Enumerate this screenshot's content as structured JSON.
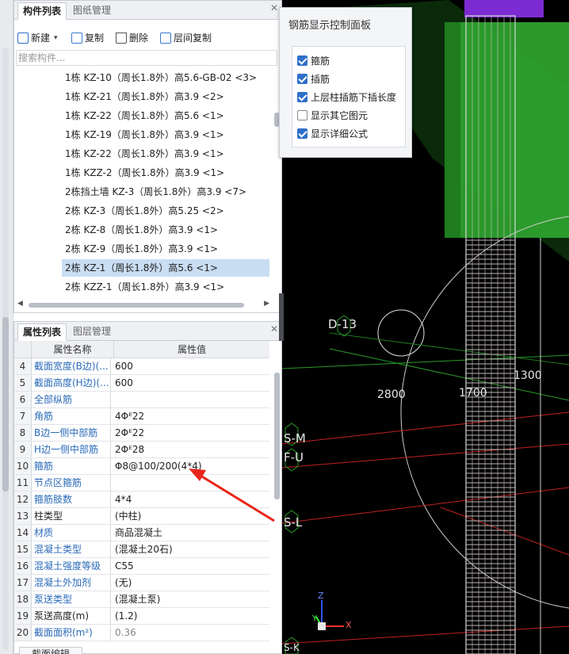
{
  "component_panel": {
    "tabs": [
      "构件列表",
      "图纸管理"
    ],
    "toolbar": {
      "new_label": "新建",
      "copy_label": "复制",
      "delete_label": "删除",
      "floor_copy_label": "层间复制"
    },
    "search_placeholder": "搜索构件...",
    "items": [
      "1栋 KZ-10（周长1.8外）高5.6-GB-02 <3>",
      "1栋 KZ-21（周长1.8外）高3.9 <2>",
      "1栋 KZ-22（周长1.8外）高5.6 <1>",
      "1栋 KZ-19（周长1.8外）高3.9 <1>",
      "1栋 KZ-22（周长1.8外）高3.9 <1>",
      "1栋 KZZ-2（周长1.8外）高3.9 <1>",
      "2栋挡土墙 KZ-3（周长1.8外）高3.9 <7>",
      "2栋 KZ-3（周长1.8外）高5.25 <2>",
      "2栋 KZ-8（周长1.8外）高3.9 <1>",
      "2栋 KZ-9（周长1.8外）高3.9 <1>",
      "2栋 KZ-1（周长1.8外）高5.6 <1>",
      "2栋 KZZ-1（周长1.8外）高3.9 <1>"
    ],
    "selected_index": 10
  },
  "property_panel": {
    "tabs": [
      "属性列表",
      "图层管理"
    ],
    "columns": [
      "属性名称",
      "属性值"
    ],
    "rows": [
      {
        "num": "4",
        "name": "截面宽度(B边)(...",
        "value": "600"
      },
      {
        "num": "5",
        "name": "截面高度(H边)(...",
        "value": "600"
      },
      {
        "num": "6",
        "name": "全部纵筋",
        "value": ""
      },
      {
        "num": "7",
        "name": "角筋",
        "value": "4Φᴱ22"
      },
      {
        "num": "8",
        "name": "B边一侧中部筋",
        "value": "2Φᴱ22"
      },
      {
        "num": "9",
        "name": "H边一侧中部筋",
        "value": "2Φᴱ28"
      },
      {
        "num": "10",
        "name": "箍筋",
        "value": "Φ8@100/200(4*4)"
      },
      {
        "num": "11",
        "name": "节点区箍筋",
        "value": ""
      },
      {
        "num": "12",
        "name": "箍筋肢数",
        "value": "4*4"
      },
      {
        "num": "13",
        "name": "柱类型",
        "value": "(中柱)"
      },
      {
        "num": "14",
        "name": "材质",
        "value": "商品混凝土"
      },
      {
        "num": "15",
        "name": "混凝土类型",
        "value": "(混凝土20石)"
      },
      {
        "num": "16",
        "name": "混凝土强度等级",
        "value": "C55"
      },
      {
        "num": "17",
        "name": "混凝土外加剂",
        "value": "(无)"
      },
      {
        "num": "18",
        "name": "泵送类型",
        "value": "(混凝土泵)"
      },
      {
        "num": "19",
        "name": "泵送高度(m)",
        "value": "(1.2)"
      },
      {
        "num": "20",
        "name": "截面面积(m²)",
        "value": "0.36"
      }
    ],
    "bottom_button": "截面编辑"
  },
  "control_panel": {
    "title": "钢筋显示控制面板",
    "options": [
      {
        "label": "箍筋",
        "checked": true
      },
      {
        "label": "插筋",
        "checked": true
      },
      {
        "label": "上层柱插筋下插长度",
        "checked": true
      },
      {
        "label": "显示其它图元",
        "checked": false
      },
      {
        "label": "显示详细公式",
        "checked": true
      }
    ]
  },
  "viewport": {
    "labels": [
      "D-13",
      "2800",
      "1700",
      "1300",
      "S-M",
      "F-U",
      "S-L",
      "S-K"
    ],
    "axis_z": "Z",
    "axis_y": "Y",
    "axis_x": "X"
  },
  "colors": {
    "accent": "#2f6fc9",
    "property_name": "#2a6ab8",
    "selected_row": "#c9ddf3",
    "arrow": "#e8261a",
    "green_volume": "#2fa52f",
    "purple_volume": "#7b2bd1"
  }
}
